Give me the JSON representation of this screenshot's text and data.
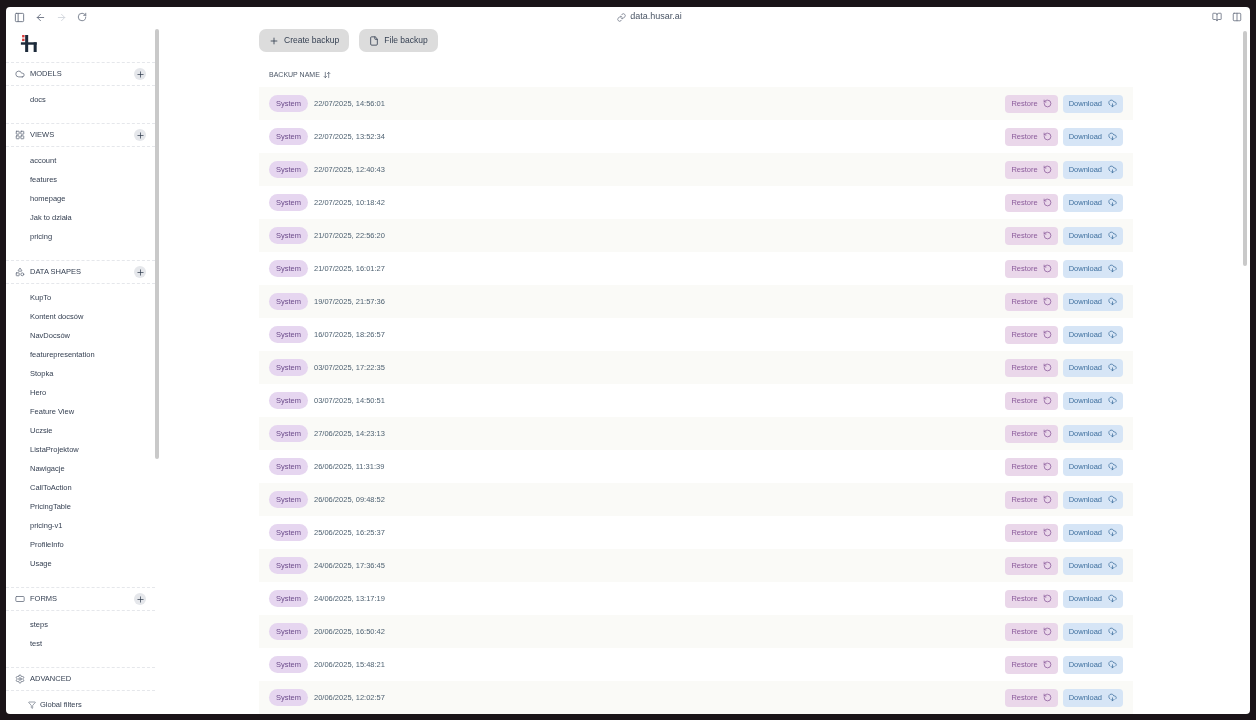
{
  "browser": {
    "url": "data.husar.ai",
    "forward_disabled": true
  },
  "sidebar": {
    "sections": [
      {
        "kind": "models",
        "title": "MODELS",
        "addable": true,
        "items": [
          "docs"
        ]
      },
      {
        "kind": "views",
        "title": "VIEWS",
        "addable": true,
        "items": [
          "account",
          "features",
          "homepage",
          "Jak to działa",
          "pricing"
        ]
      },
      {
        "kind": "data_shapes",
        "title": "DATA SHAPES",
        "addable": true,
        "items": [
          "KupTo",
          "Kontent docsów",
          "NavDocsów",
          "featurepresentation",
          "Stopka",
          "Hero",
          "Feature View",
          "Uczsie",
          "ListaProjektow",
          "Nawigacje",
          "CallToAction",
          "PricingTable",
          "pricing-v1",
          "ProfileInfo",
          "Usage"
        ]
      },
      {
        "kind": "forms",
        "title": "FORMS",
        "addable": true,
        "items": [
          "steps",
          "test"
        ]
      },
      {
        "kind": "advanced",
        "title": "ADVANCED",
        "addable": false,
        "items": [
          "Global filters"
        ]
      }
    ]
  },
  "toolbar": [
    "Create backup",
    "File backup"
  ],
  "table": {
    "column": "BACKUP NAME",
    "rows": [
      {
        "tag": "System",
        "date": "22/07/2025, 14:56:01",
        "restore": "Restore",
        "download": "Download"
      },
      {
        "tag": "System",
        "date": "22/07/2025, 13:52:34",
        "restore": "Restore",
        "download": "Download"
      },
      {
        "tag": "System",
        "date": "22/07/2025, 12:40:43",
        "restore": "Restore",
        "download": "Download"
      },
      {
        "tag": "System",
        "date": "22/07/2025, 10:18:42",
        "restore": "Restore",
        "download": "Download"
      },
      {
        "tag": "System",
        "date": "21/07/2025, 22:56:20",
        "restore": "Restore",
        "download": "Download"
      },
      {
        "tag": "System",
        "date": "21/07/2025, 16:01:27",
        "restore": "Restore",
        "download": "Download"
      },
      {
        "tag": "System",
        "date": "19/07/2025, 21:57:36",
        "restore": "Restore",
        "download": "Download"
      },
      {
        "tag": "System",
        "date": "16/07/2025, 18:26:57",
        "restore": "Restore",
        "download": "Download"
      },
      {
        "tag": "System",
        "date": "03/07/2025, 17:22:35",
        "restore": "Restore",
        "download": "Download"
      },
      {
        "tag": "System",
        "date": "03/07/2025, 14:50:51",
        "restore": "Restore",
        "download": "Download"
      },
      {
        "tag": "System",
        "date": "27/06/2025, 14:23:13",
        "restore": "Restore",
        "download": "Download"
      },
      {
        "tag": "System",
        "date": "26/06/2025, 11:31:39",
        "restore": "Restore",
        "download": "Download"
      },
      {
        "tag": "System",
        "date": "26/06/2025, 09:48:52",
        "restore": "Restore",
        "download": "Download"
      },
      {
        "tag": "System",
        "date": "25/06/2025, 16:25:37",
        "restore": "Restore",
        "download": "Download"
      },
      {
        "tag": "System",
        "date": "24/06/2025, 17:36:45",
        "restore": "Restore",
        "download": "Download"
      },
      {
        "tag": "System",
        "date": "24/06/2025, 13:17:19",
        "restore": "Restore",
        "download": "Download"
      },
      {
        "tag": "System",
        "date": "20/06/2025, 16:50:42",
        "restore": "Restore",
        "download": "Download"
      },
      {
        "tag": "System",
        "date": "20/06/2025, 15:48:21",
        "restore": "Restore",
        "download": "Download"
      },
      {
        "tag": "System",
        "date": "20/06/2025, 12:02:57",
        "restore": "Restore",
        "download": "Download"
      }
    ]
  }
}
